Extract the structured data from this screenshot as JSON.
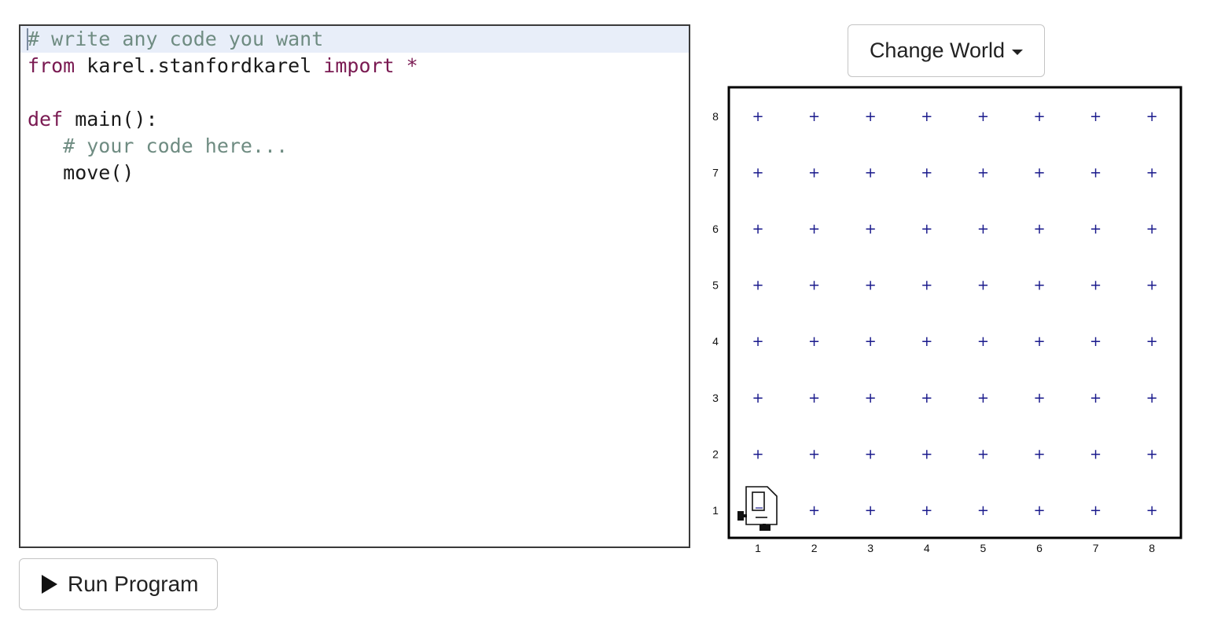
{
  "editor": {
    "lines": [
      [
        {
          "t": "# write any code you want",
          "c": "cm"
        }
      ],
      [
        {
          "t": "from",
          "c": "kw"
        },
        {
          "t": " karel.stanfordkarel ",
          "c": ""
        },
        {
          "t": "import",
          "c": "kw"
        },
        {
          "t": " ",
          "c": ""
        },
        {
          "t": "*",
          "c": "kw"
        }
      ],
      [],
      [
        {
          "t": "def",
          "c": "kw"
        },
        {
          "t": " main():",
          "c": ""
        }
      ],
      [
        {
          "t": "   ",
          "c": ""
        },
        {
          "t": "# your code here...",
          "c": "cm"
        }
      ],
      [
        {
          "t": "   move()",
          "c": ""
        }
      ]
    ]
  },
  "run_button": {
    "label": "Run Program",
    "icon": "play-icon"
  },
  "change_world_button": {
    "label": "Change World",
    "icon": "caret-down-icon"
  },
  "world": {
    "columns": 8,
    "rows": 8,
    "x_labels": [
      "1",
      "2",
      "3",
      "4",
      "5",
      "6",
      "7",
      "8"
    ],
    "y_labels": [
      "1",
      "2",
      "3",
      "4",
      "5",
      "6",
      "7",
      "8"
    ],
    "corner_marker": "+",
    "corner_color": "#1a1a8c",
    "karel": {
      "avenue": 1,
      "street": 1,
      "facing": "east",
      "icon": "karel-robot-icon"
    }
  }
}
